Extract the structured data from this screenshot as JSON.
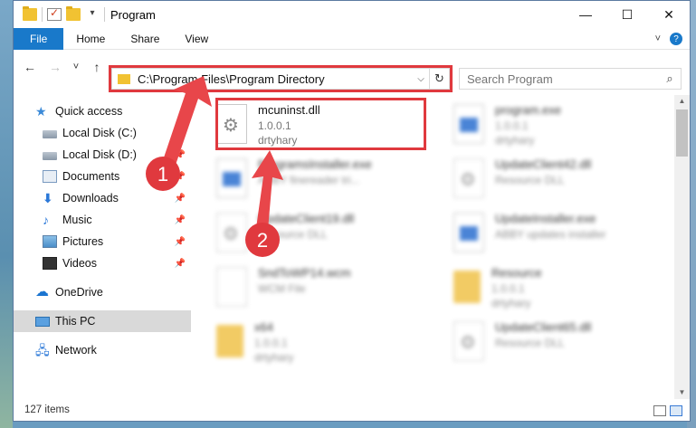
{
  "window": {
    "title": "Program",
    "controls": {
      "minimize": "—",
      "maximize": "☐",
      "close": "✕"
    }
  },
  "ribbon": {
    "tabs": [
      "File",
      "Home",
      "Share",
      "View"
    ]
  },
  "nav": {
    "back": "←",
    "forward": "→",
    "recent": "˅",
    "up": "↑",
    "address": "C:\\Program Files\\Program Directory",
    "search_placeholder": "Search Program"
  },
  "sidebar": {
    "items": [
      {
        "label": "Quick access",
        "icon": "star-icon"
      },
      {
        "label": "Local Disk (C:)",
        "icon": "drive-icon",
        "pinned": true
      },
      {
        "label": "Local Disk (D:)",
        "icon": "drive-icon",
        "pinned": true
      },
      {
        "label": "Documents",
        "icon": "documents-icon",
        "pinned": true
      },
      {
        "label": "Downloads",
        "icon": "download-icon",
        "pinned": true
      },
      {
        "label": "Music",
        "icon": "music-icon",
        "pinned": true
      },
      {
        "label": "Pictures",
        "icon": "pictures-icon",
        "pinned": true
      },
      {
        "label": "Videos",
        "icon": "videos-icon",
        "pinned": true
      },
      {
        "label": "OneDrive",
        "icon": "cloud-icon"
      },
      {
        "label": "This PC",
        "icon": "computer-icon",
        "selected": true
      },
      {
        "label": "Network",
        "icon": "network-icon"
      }
    ]
  },
  "files": [
    {
      "name": "mcuninst.dll",
      "line2": "1.0.0.1",
      "line3": "drtyhary",
      "type": "dll",
      "highlighted": true
    },
    {
      "name": "program.exe",
      "line2": "1.0.0.1",
      "line3": "drtyhary",
      "type": "exe"
    },
    {
      "name": "ProgramsInstaller.exe",
      "line2": "ABBY finereader tri...",
      "line3": "",
      "type": "exe"
    },
    {
      "name": "UpdateClient42.dll",
      "line2": "Resource DLL",
      "line3": "",
      "type": "dll"
    },
    {
      "name": "UpdateClient19.dll",
      "line2": "Resource DLL",
      "line3": "",
      "type": "dll"
    },
    {
      "name": "UpdateInstaller.exe",
      "line2": "ABBY updates installer",
      "line3": "",
      "type": "exe"
    },
    {
      "name": "SndToWP14.wcm",
      "line2": "WCM File",
      "line3": "",
      "type": "file"
    },
    {
      "name": "Resource",
      "line2": "1.0.0.1",
      "line3": "drtyhary",
      "type": "folder"
    },
    {
      "name": "x64",
      "line2": "1.0.0.1",
      "line3": "drtyhary",
      "type": "folder"
    },
    {
      "name": "UpdateClient65.dll",
      "line2": "Resource DLL",
      "line3": "",
      "type": "dll"
    }
  ],
  "status": {
    "item_count": "127 items"
  },
  "annotations": {
    "badge1": "1",
    "badge2": "2",
    "accent": "#e0393e"
  }
}
